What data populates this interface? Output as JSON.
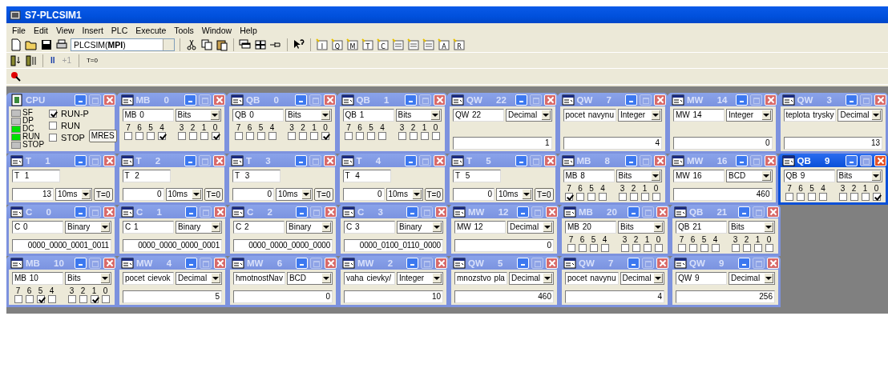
{
  "window": {
    "title": "S7-PLCSIM1"
  },
  "menu": [
    "File",
    "Edit",
    "View",
    "Insert",
    "PLC",
    "Execute",
    "Tools",
    "Window",
    "Help"
  ],
  "toolbar": {
    "combo": "PLCSIM(**MPI**)",
    "insert_buttons": [
      {
        "kind": "letter",
        "glyph": "I"
      },
      {
        "kind": "letter",
        "glyph": "Q"
      },
      {
        "kind": "letter",
        "glyph": "M"
      },
      {
        "kind": "letter",
        "glyph": "T"
      },
      {
        "kind": "letter",
        "glyph": "C"
      },
      {
        "kind": "plain"
      },
      {
        "kind": "plain"
      },
      {
        "kind": "plain"
      },
      {
        "kind": "letter",
        "glyph": "A"
      },
      {
        "kind": "letter",
        "glyph": "R"
      }
    ]
  },
  "run_toolbar": {
    "pause": "II",
    "step": {
      "label": "+1",
      "disabled": true
    },
    "reset": "T=0"
  },
  "rows": [
    {
      "windows": [
        {
          "kind": "cpu",
          "title": "CPU",
          "active": false,
          "leds": [
            {
              "label": "SF",
              "on": false
            },
            {
              "label": "DP",
              "on": false
            },
            {
              "label": "DC",
              "on": true
            },
            {
              "label": "RUN",
              "on": true
            },
            {
              "label": "STOP",
              "on": false
            }
          ],
          "modes": [
            {
              "label": "RUN-P",
              "checked": true
            },
            {
              "label": "RUN",
              "checked": false
            },
            {
              "label": "STOP",
              "checked": false
            }
          ],
          "button": "MRES"
        },
        {
          "kind": "bits",
          "title": "MB 0",
          "active": false,
          "address": "MB 0",
          "format": "Bits",
          "bits": [
            {
              "label": "7",
              "checked": false
            },
            {
              "label": "6",
              "checked": false
            },
            {
              "label": "5",
              "checked": false
            },
            {
              "label": "4",
              "checked": true
            },
            {
              "label": "3",
              "checked": false
            },
            {
              "label": "2",
              "checked": false
            },
            {
              "label": "1",
              "checked": false
            },
            {
              "label": "0",
              "checked": true
            }
          ]
        },
        {
          "kind": "bits",
          "title": "QB 0",
          "active": false,
          "address": "QB 0",
          "format": "Bits",
          "bits": [
            {
              "label": "7",
              "checked": false
            },
            {
              "label": "6",
              "checked": false
            },
            {
              "label": "5",
              "checked": false
            },
            {
              "label": "4",
              "checked": false
            },
            {
              "label": "3",
              "checked": false
            },
            {
              "label": "2",
              "checked": false
            },
            {
              "label": "1",
              "checked": false
            },
            {
              "label": "0",
              "checked": true
            }
          ]
        },
        {
          "kind": "bits",
          "title": "QB 1",
          "active": false,
          "address": "QB 1",
          "format": "Bits",
          "bits": [
            {
              "label": "7",
              "checked": false
            },
            {
              "label": "6",
              "checked": false
            },
            {
              "label": "5",
              "checked": false
            },
            {
              "label": "4",
              "checked": false
            },
            {
              "label": "3",
              "checked": false
            },
            {
              "label": "2",
              "checked": false
            },
            {
              "label": "1",
              "checked": false
            },
            {
              "label": "0",
              "checked": false
            }
          ]
        },
        {
          "kind": "value",
          "title": "QW 22",
          "active": false,
          "address": "QW 22",
          "format": "Decimal",
          "value": "1"
        },
        {
          "kind": "value",
          "title": "QW 7",
          "active": false,
          "address": "pocet navynu",
          "format": "Integer",
          "value": "4"
        },
        {
          "kind": "value",
          "title": "MW 14",
          "active": false,
          "address": "MW 14",
          "format": "Integer",
          "value": "0"
        },
        {
          "kind": "value",
          "title": "QW 3",
          "active": false,
          "address": "teplota trysky",
          "format": "Decimal",
          "value": "13"
        }
      ]
    },
    {
      "windows": [
        {
          "kind": "timer",
          "title": "T 1",
          "active": false,
          "address": "T 1",
          "value": "13",
          "timebase": "10ms",
          "button": "T=0"
        },
        {
          "kind": "timer",
          "title": "T 2",
          "active": false,
          "address": "T 2",
          "value": "0",
          "timebase": "10ms",
          "button": "T=0"
        },
        {
          "kind": "timer",
          "title": "T 3",
          "active": false,
          "address": "T 3",
          "value": "0",
          "timebase": "10ms",
          "button": "T=0"
        },
        {
          "kind": "timer",
          "title": "T 4",
          "active": false,
          "address": "T 4",
          "value": "0",
          "timebase": "10ms",
          "button": "T=0"
        },
        {
          "kind": "timer",
          "title": "T 5",
          "active": false,
          "address": "T 5",
          "value": "0",
          "timebase": "10ms",
          "button": "T=0"
        },
        {
          "kind": "bits",
          "title": "MB 8",
          "active": false,
          "address": "MB 8",
          "format": "Bits",
          "bits": [
            {
              "label": "7",
              "checked": true
            },
            {
              "label": "6",
              "checked": false
            },
            {
              "label": "5",
              "checked": false
            },
            {
              "label": "4",
              "checked": false
            },
            {
              "label": "3",
              "checked": false
            },
            {
              "label": "2",
              "checked": false
            },
            {
              "label": "1",
              "checked": false
            },
            {
              "label": "0",
              "checked": false
            }
          ]
        },
        {
          "kind": "value",
          "title": "MW 16",
          "active": false,
          "address": "MW 16",
          "format": "BCD",
          "value": "460"
        },
        {
          "kind": "bits",
          "title": "QB 9",
          "active": true,
          "address": "QB 9",
          "format": "Bits",
          "bits": [
            {
              "label": "7",
              "checked": false
            },
            {
              "label": "6",
              "checked": false
            },
            {
              "label": "5",
              "checked": false
            },
            {
              "label": "4",
              "checked": false
            },
            {
              "label": "3",
              "checked": false
            },
            {
              "label": "2",
              "checked": false
            },
            {
              "label": "1",
              "checked": false
            },
            {
              "label": "0",
              "checked": true
            }
          ]
        }
      ]
    },
    {
      "windows": [
        {
          "kind": "counter",
          "title": "C 0",
          "active": false,
          "address": "C 0",
          "format": "Binary",
          "value": "0000_0000_0001_0011"
        },
        {
          "kind": "counter",
          "title": "C 1",
          "active": false,
          "address": "C 1",
          "format": "Binary",
          "value": "0000_0000_0000_0001"
        },
        {
          "kind": "counter",
          "title": "C 2",
          "active": false,
          "address": "C 2",
          "format": "Binary",
          "value": "0000_0000_0000_0000"
        },
        {
          "kind": "counter",
          "title": "C 3",
          "active": false,
          "address": "C 3",
          "format": "Binary",
          "value": "0000_0100_0110_0000"
        },
        {
          "kind": "value",
          "title": "MW 12",
          "active": false,
          "address": "MW 12",
          "format": "Decimal",
          "value": "0"
        },
        {
          "kind": "bits",
          "title": "MB 20",
          "active": false,
          "address": "MB 20",
          "format": "Bits",
          "bits": [
            {
              "label": "7",
              "checked": false
            },
            {
              "label": "6",
              "checked": false
            },
            {
              "label": "5",
              "checked": false
            },
            {
              "label": "4",
              "checked": false
            },
            {
              "label": "3",
              "checked": false
            },
            {
              "label": "2",
              "checked": false
            },
            {
              "label": "1",
              "checked": false
            },
            {
              "label": "0",
              "checked": false
            }
          ]
        },
        {
          "kind": "bits",
          "title": "QB 21",
          "active": false,
          "address": "QB 21",
          "format": "Bits",
          "bits": [
            {
              "label": "7",
              "checked": false
            },
            {
              "label": "6",
              "checked": false
            },
            {
              "label": "5",
              "checked": false
            },
            {
              "label": "4",
              "checked": false
            },
            {
              "label": "3",
              "checked": false
            },
            {
              "label": "2",
              "checked": false
            },
            {
              "label": "1",
              "checked": false
            },
            {
              "label": "0",
              "checked": false
            }
          ]
        }
      ]
    },
    {
      "windows": [
        {
          "kind": "bits",
          "title": "MB 10",
          "active": false,
          "address": "MB 10",
          "format": "Bits",
          "bits": [
            {
              "label": "7",
              "checked": false
            },
            {
              "label": "6",
              "checked": false
            },
            {
              "label": "5",
              "checked": true
            },
            {
              "label": "4",
              "checked": false
            },
            {
              "label": "3",
              "checked": false
            },
            {
              "label": "2",
              "checked": false
            },
            {
              "label": "1",
              "checked": true
            },
            {
              "label": "0",
              "checked": false
            }
          ]
        },
        {
          "kind": "value",
          "title": "MW 4",
          "active": false,
          "address": "pocet cievok",
          "format": "Decimal",
          "value": "5"
        },
        {
          "kind": "value",
          "title": "MW 6",
          "active": false,
          "address": "hmotnostNav",
          "format": "BCD",
          "value": "0"
        },
        {
          "kind": "value",
          "title": "MW 2",
          "active": false,
          "address": "vaha cievky/",
          "format": "Integer",
          "value": "10"
        },
        {
          "kind": "value",
          "title": "QW 5",
          "active": false,
          "address": "mnozstvo pla",
          "format": "Decimal",
          "value": "460"
        },
        {
          "kind": "value",
          "title": "QW 7",
          "active": false,
          "address": "pocet navynu",
          "format": "Decimal",
          "value": "4"
        },
        {
          "kind": "value",
          "title": "QW 9",
          "active": false,
          "address": "QW 9",
          "format": "Decimal",
          "value": "256"
        }
      ]
    }
  ]
}
